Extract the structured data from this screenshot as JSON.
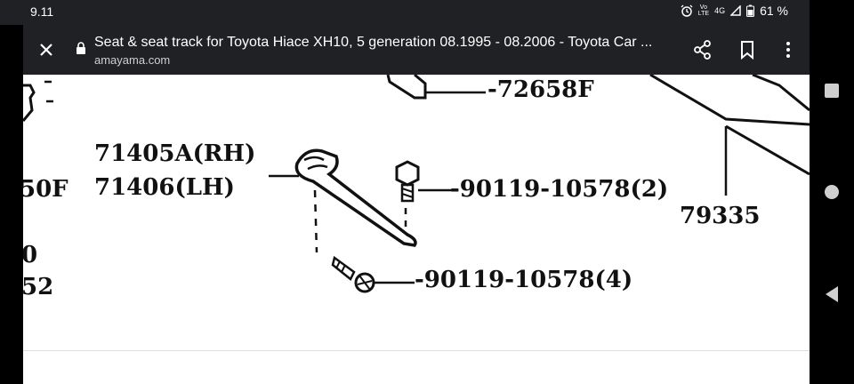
{
  "status": {
    "time": "9.11",
    "network_top": "Vo",
    "network_bottom": "LTE",
    "signal": "4G",
    "battery": "61 %"
  },
  "browser": {
    "title": "Seat & seat track for Toyota Hiace XH10, 5 generation 08.1995 - 08.2006 - Toyota Car ...",
    "url": "amayama.com"
  },
  "diagram": {
    "labels": {
      "part_72658f": "-72658F",
      "part_71405a": "71405A(RH)",
      "part_71406": "71406(LH)",
      "part_50f": "50F",
      "part_bolt_top": "-90119-10578(2)",
      "part_79335": "79335",
      "part_bolt_bottom": "-90119-10578(4)",
      "edge_0": "0",
      "edge_52": "52"
    }
  },
  "colors": {
    "toolbar": "#202124",
    "page": "#ffffff",
    "ink": "#111111"
  }
}
